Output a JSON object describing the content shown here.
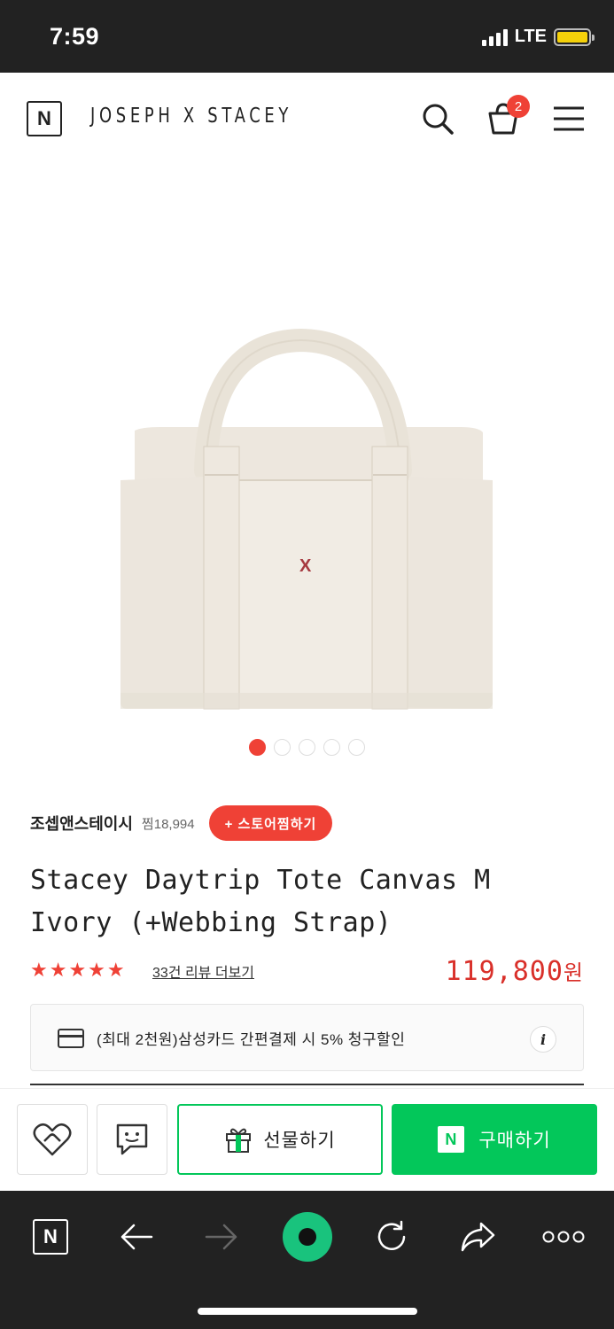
{
  "status_bar": {
    "time": "7:59",
    "network": "LTE",
    "battery_color": "#f5d10a"
  },
  "header": {
    "logo_letter": "N",
    "brand": "JOSEPH X STACEY",
    "cart_count": "2",
    "icons": [
      "search-icon",
      "cart-icon",
      "menu-icon"
    ]
  },
  "gallery": {
    "total_images": 5,
    "active_index": 0,
    "logo_mark": "X"
  },
  "store": {
    "name": "조셉앤스테이시",
    "favorites": "찜18,994",
    "follow_label": "+ 스토어찜하기"
  },
  "product": {
    "title": "Stacey Daytrip Tote Canvas M Ivory (+Webbing Strap)",
    "rating": 5,
    "stars": "★★★★★",
    "review_link": "33건 리뷰 더보기",
    "price": "119,800",
    "currency": "원",
    "accent_color": "#ef4136"
  },
  "promo": {
    "text": "(최대 2천원)삼성카드 간편결제 시 5% 청구할인",
    "info_label": "i"
  },
  "actions": {
    "wishlist_icon": "heart-icon",
    "chat_icon": "talk-icon",
    "gift_label": "선물하기",
    "buy_label": "구매하기",
    "buy_logo": "N",
    "buy_color": "#03c75a"
  },
  "browser_bar": {
    "logo_letter": "N",
    "items": [
      "naver-icon",
      "back-icon",
      "forward-icon",
      "green-dot-icon",
      "reload-icon",
      "share-icon",
      "more-icon"
    ]
  }
}
